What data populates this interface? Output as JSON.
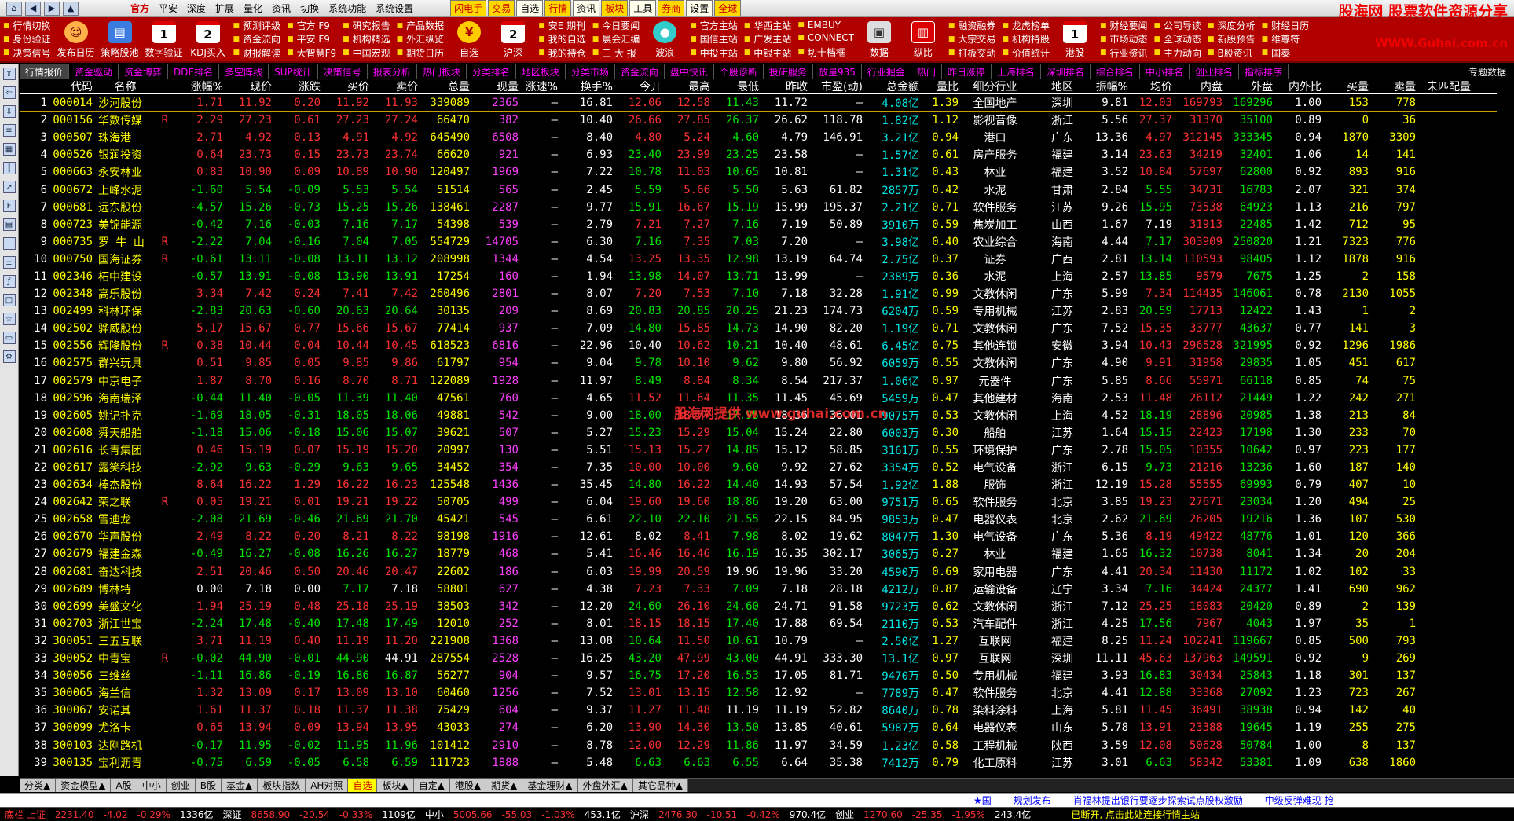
{
  "menubar": {
    "items": [
      "官方",
      "平安",
      "深度",
      "扩展",
      "量化",
      "资讯",
      "切换",
      "系统功能",
      "系统设置"
    ],
    "quick": [
      "闪电手",
      "交易",
      "自选",
      "行情",
      "资讯",
      "板块",
      "工具",
      "券商",
      "设置",
      "全球"
    ],
    "brand": "股海网 股票软件资源分享",
    "brand_sub": "WWW.Guhai.com.cn"
  },
  "toolbar": {
    "g1": [
      "行情切换",
      "身份验证",
      "决策信号"
    ],
    "big1": "发布日历",
    "big2": "策略股池",
    "big3": "数字验证",
    "big4": "KDJ买入",
    "g2": [
      "预测评级",
      "资金流向",
      "财报解读"
    ],
    "g3": [
      "官方 F9",
      "平安 F9",
      "大智慧F9"
    ],
    "g4": [
      "研究报告",
      "机构精选",
      "中国宏观"
    ],
    "g5": [
      "产品数据",
      "外汇纵览",
      "期货日历"
    ],
    "big5": "自选",
    "big6": "沪深",
    "g6": [
      "安E 期刊",
      "我的自选",
      "我的持仓"
    ],
    "g7": [
      "今日要闻",
      "晨会汇编",
      "三 大 报"
    ],
    "big7": "波浪",
    "g8": [
      "官方主站",
      "国信主站",
      "中投主站"
    ],
    "g9": [
      "华西主站",
      "广发主站",
      "中银主站"
    ],
    "g10": [
      "EMBUY",
      "CONNECT",
      "切十档框"
    ],
    "big8": "数据",
    "big9": "纵比",
    "g11": [
      "融资融券",
      "大宗交易",
      "打板交动"
    ],
    "g12": [
      "龙虎榜单",
      "机构持股",
      "价值统计"
    ],
    "big10": "港股",
    "g13": [
      "财经要闻",
      "市场动态",
      "行业资讯"
    ],
    "g14": [
      "公司导读",
      "全球动态",
      "主力动向"
    ],
    "g15": [
      "深度分析",
      "新股预告",
      "B股资讯"
    ],
    "g16": [
      "财经日历",
      "维尊符",
      "国泰"
    ]
  },
  "tabs": [
    "行情报价",
    "资金驱动",
    "资金博弈",
    "DDE排名",
    "多空阵线",
    "SUP统计",
    "决策信号",
    "报表分析",
    "热门板块",
    "分类排名",
    "地区板块",
    "分类市场",
    "资金流向",
    "盘中快讯",
    "个股诊断",
    "投研服务",
    "放量935",
    "行业掘金",
    "热门",
    "昨日涨停",
    "上海排名",
    "深圳排名",
    "综合排名",
    "中小排名",
    "创业排名",
    "指标排序"
  ],
  "tab_right": "专题数据",
  "headers": [
    "",
    "代码",
    "名称",
    "",
    "涨幅%",
    "现价",
    "涨跌",
    "买价",
    "卖价",
    "总量",
    "现量",
    "涨速%",
    "换手%",
    "今开",
    "最高",
    "最低",
    "昨收",
    "市盈(动)",
    "总金额",
    "量比",
    "细分行业",
    "地区",
    "振幅%",
    "均价",
    "内盘",
    "外盘",
    "内外比",
    "买量",
    "卖量",
    "未匹配量"
  ],
  "rows": [
    [
      "1",
      "000014",
      "沙河股份",
      "",
      "1.71",
      "11.92",
      "0.20",
      "11.92",
      "11.93",
      "339089",
      "2365",
      "–",
      "16.81",
      "12.06",
      "12.58",
      "11.43",
      "11.72",
      "–",
      "4.08亿",
      "1.39",
      "全国地产",
      "深圳",
      "9.81",
      "12.03",
      "169793",
      "169296",
      "1.00",
      "153",
      "778",
      ""
    ],
    [
      "2",
      "000156",
      "华数传媒",
      "R",
      "2.29",
      "27.23",
      "0.61",
      "27.23",
      "27.24",
      "66470",
      "382",
      "–",
      "10.40",
      "26.66",
      "27.85",
      "26.37",
      "26.62",
      "118.78",
      "1.82亿",
      "1.12",
      "影视音像",
      "浙江",
      "5.56",
      "27.37",
      "31370",
      "35100",
      "0.89",
      "0",
      "36",
      ""
    ],
    [
      "3",
      "000507",
      "珠海港",
      "",
      "2.71",
      "4.92",
      "0.13",
      "4.91",
      "4.92",
      "645490",
      "6508",
      "–",
      "8.40",
      "4.80",
      "5.24",
      "4.60",
      "4.79",
      "146.91",
      "3.21亿",
      "0.94",
      "港口",
      "广东",
      "13.36",
      "4.97",
      "312145",
      "333345",
      "0.94",
      "1870",
      "3309",
      ""
    ],
    [
      "4",
      "000526",
      "银润投资",
      "",
      "0.64",
      "23.73",
      "0.15",
      "23.73",
      "23.74",
      "66620",
      "921",
      "–",
      "6.93",
      "23.40",
      "23.99",
      "23.25",
      "23.58",
      "–",
      "1.57亿",
      "0.61",
      "房产服务",
      "福建",
      "3.14",
      "23.63",
      "34219",
      "32401",
      "1.06",
      "14",
      "141",
      ""
    ],
    [
      "5",
      "000663",
      "永安林业",
      "",
      "0.83",
      "10.90",
      "0.09",
      "10.89",
      "10.90",
      "120497",
      "1969",
      "–",
      "7.22",
      "10.78",
      "11.03",
      "10.65",
      "10.81",
      "–",
      "1.31亿",
      "0.43",
      "林业",
      "福建",
      "3.52",
      "10.84",
      "57697",
      "62800",
      "0.92",
      "893",
      "916",
      ""
    ],
    [
      "6",
      "000672",
      "上峰水泥",
      "",
      "-1.60",
      "5.54",
      "-0.09",
      "5.53",
      "5.54",
      "51514",
      "565",
      "–",
      "2.45",
      "5.59",
      "5.66",
      "5.50",
      "5.63",
      "61.82",
      "2857万",
      "0.42",
      "水泥",
      "甘肃",
      "2.84",
      "5.55",
      "34731",
      "16783",
      "2.07",
      "321",
      "374",
      ""
    ],
    [
      "7",
      "000681",
      "远东股份",
      "",
      "-4.57",
      "15.26",
      "-0.73",
      "15.25",
      "15.26",
      "138461",
      "2287",
      "–",
      "9.77",
      "15.91",
      "16.67",
      "15.19",
      "15.99",
      "195.37",
      "2.21亿",
      "0.71",
      "软件服务",
      "江苏",
      "9.26",
      "15.95",
      "73538",
      "64923",
      "1.13",
      "216",
      "797",
      ""
    ],
    [
      "8",
      "000723",
      "美锦能源",
      "",
      "-0.42",
      "7.16",
      "-0.03",
      "7.16",
      "7.17",
      "54398",
      "539",
      "–",
      "2.79",
      "7.21",
      "7.27",
      "7.16",
      "7.19",
      "50.89",
      "3910万",
      "0.59",
      "焦炭加工",
      "山西",
      "1.67",
      "7.19",
      "31913",
      "22485",
      "1.42",
      "712",
      "95",
      ""
    ],
    [
      "9",
      "000735",
      "罗 牛 山",
      "R",
      "-2.22",
      "7.04",
      "-0.16",
      "7.04",
      "7.05",
      "554729",
      "14705",
      "–",
      "6.30",
      "7.16",
      "7.35",
      "7.03",
      "7.20",
      "–",
      "3.98亿",
      "0.40",
      "农业综合",
      "海南",
      "4.44",
      "7.17",
      "303909",
      "250820",
      "1.21",
      "7323",
      "776",
      ""
    ],
    [
      "10",
      "000750",
      "国海证券",
      "R",
      "-0.61",
      "13.11",
      "-0.08",
      "13.11",
      "13.12",
      "208998",
      "1344",
      "–",
      "4.54",
      "13.25",
      "13.35",
      "12.98",
      "13.19",
      "64.74",
      "2.75亿",
      "0.37",
      "证券",
      "广西",
      "2.81",
      "13.14",
      "110593",
      "98405",
      "1.12",
      "1878",
      "916",
      ""
    ],
    [
      "11",
      "002346",
      "柘中建设",
      "",
      "-0.57",
      "13.91",
      "-0.08",
      "13.90",
      "13.91",
      "17254",
      "160",
      "–",
      "1.94",
      "13.98",
      "14.07",
      "13.71",
      "13.99",
      "–",
      "2389万",
      "0.36",
      "水泥",
      "上海",
      "2.57",
      "13.85",
      "9579",
      "7675",
      "1.25",
      "2",
      "158",
      ""
    ],
    [
      "12",
      "002348",
      "高乐股份",
      "",
      "3.34",
      "7.42",
      "0.24",
      "7.41",
      "7.42",
      "260496",
      "2801",
      "–",
      "8.07",
      "7.20",
      "7.53",
      "7.10",
      "7.18",
      "32.28",
      "1.91亿",
      "0.99",
      "文教休闲",
      "广东",
      "5.99",
      "7.34",
      "114435",
      "146061",
      "0.78",
      "2130",
      "1055",
      ""
    ],
    [
      "13",
      "002499",
      "科林环保",
      "",
      "-2.83",
      "20.63",
      "-0.60",
      "20.63",
      "20.64",
      "30135",
      "209",
      "–",
      "8.69",
      "20.83",
      "20.85",
      "20.25",
      "21.23",
      "174.73",
      "6204万",
      "0.59",
      "专用机械",
      "江苏",
      "2.83",
      "20.59",
      "17713",
      "12422",
      "1.43",
      "1",
      "2",
      ""
    ],
    [
      "14",
      "002502",
      "骅威股份",
      "",
      "5.17",
      "15.67",
      "0.77",
      "15.66",
      "15.67",
      "77414",
      "937",
      "–",
      "7.09",
      "14.80",
      "15.85",
      "14.73",
      "14.90",
      "82.20",
      "1.19亿",
      "0.71",
      "文教休闲",
      "广东",
      "7.52",
      "15.35",
      "33777",
      "43637",
      "0.77",
      "141",
      "3",
      ""
    ],
    [
      "15",
      "002556",
      "辉隆股份",
      "R",
      "0.38",
      "10.44",
      "0.04",
      "10.44",
      "10.45",
      "618523",
      "6816",
      "–",
      "22.96",
      "10.40",
      "10.62",
      "10.21",
      "10.40",
      "48.61",
      "6.45亿",
      "0.75",
      "其他连锁",
      "安徽",
      "3.94",
      "10.43",
      "296528",
      "321995",
      "0.92",
      "1296",
      "1986",
      ""
    ],
    [
      "16",
      "002575",
      "群兴玩具",
      "",
      "0.51",
      "9.85",
      "0.05",
      "9.85",
      "9.86",
      "61797",
      "954",
      "–",
      "9.04",
      "9.78",
      "10.10",
      "9.62",
      "9.80",
      "56.92",
      "6059万",
      "0.55",
      "文教休闲",
      "广东",
      "4.90",
      "9.91",
      "31958",
      "29835",
      "1.05",
      "451",
      "617",
      ""
    ],
    [
      "17",
      "002579",
      "中京电子",
      "",
      "1.87",
      "8.70",
      "0.16",
      "8.70",
      "8.71",
      "122089",
      "1928",
      "–",
      "11.97",
      "8.49",
      "8.84",
      "8.34",
      "8.54",
      "217.37",
      "1.06亿",
      "0.97",
      "元器件",
      "广东",
      "5.85",
      "8.66",
      "55971",
      "66118",
      "0.85",
      "74",
      "75",
      ""
    ],
    [
      "18",
      "002596",
      "海南瑞泽",
      "",
      "-0.44",
      "11.40",
      "-0.05",
      "11.39",
      "11.40",
      "47561",
      "760",
      "–",
      "4.65",
      "11.52",
      "11.64",
      "11.35",
      "11.45",
      "45.69",
      "5459万",
      "0.47",
      "其他建材",
      "海南",
      "2.53",
      "11.48",
      "26112",
      "21449",
      "1.22",
      "242",
      "271",
      ""
    ],
    [
      "19",
      "002605",
      "姚记扑克",
      "",
      "-1.69",
      "18.05",
      "-0.31",
      "18.05",
      "18.06",
      "49881",
      "542",
      "–",
      "9.00",
      "18.00",
      "18.77",
      "17.95",
      "18.36",
      "36.01",
      "9075万",
      "0.53",
      "文教休闲",
      "上海",
      "4.52",
      "18.19",
      "28896",
      "20985",
      "1.38",
      "213",
      "84",
      ""
    ],
    [
      "20",
      "002608",
      "舜天船舶",
      "",
      "-1.18",
      "15.06",
      "-0.18",
      "15.06",
      "15.07",
      "39621",
      "507",
      "–",
      "5.27",
      "15.23",
      "15.29",
      "15.04",
      "15.24",
      "22.80",
      "6003万",
      "0.30",
      "船舶",
      "江苏",
      "1.64",
      "15.15",
      "22423",
      "17198",
      "1.30",
      "233",
      "70",
      ""
    ],
    [
      "21",
      "002616",
      "长青集团",
      "",
      "0.46",
      "15.19",
      "0.07",
      "15.19",
      "15.20",
      "20997",
      "130",
      "–",
      "5.51",
      "15.13",
      "15.27",
      "14.85",
      "15.12",
      "58.85",
      "3161万",
      "0.55",
      "环境保护",
      "广东",
      "2.78",
      "15.05",
      "10355",
      "10642",
      "0.97",
      "223",
      "177",
      ""
    ],
    [
      "22",
      "002617",
      "露笑科技",
      "",
      "-2.92",
      "9.63",
      "-0.29",
      "9.63",
      "9.65",
      "34452",
      "354",
      "–",
      "7.35",
      "10.00",
      "10.00",
      "9.60",
      "9.92",
      "27.62",
      "3354万",
      "0.52",
      "电气设备",
      "浙江",
      "6.15",
      "9.73",
      "21216",
      "13236",
      "1.60",
      "187",
      "140",
      ""
    ],
    [
      "23",
      "002634",
      "棒杰股份",
      "",
      "8.64",
      "16.22",
      "1.29",
      "16.22",
      "16.23",
      "125548",
      "1436",
      "–",
      "35.45",
      "14.80",
      "16.22",
      "14.40",
      "14.93",
      "57.54",
      "1.92亿",
      "1.88",
      "服饰",
      "浙江",
      "12.19",
      "15.28",
      "55555",
      "69993",
      "0.79",
      "407",
      "10",
      ""
    ],
    [
      "24",
      "002642",
      "荣之联",
      "R",
      "0.05",
      "19.21",
      "0.01",
      "19.21",
      "19.22",
      "50705",
      "499",
      "–",
      "6.04",
      "19.60",
      "19.60",
      "18.86",
      "19.20",
      "63.00",
      "9751万",
      "0.65",
      "软件服务",
      "北京",
      "3.85",
      "19.23",
      "27671",
      "23034",
      "1.20",
      "494",
      "25",
      ""
    ],
    [
      "25",
      "002658",
      "雪迪龙",
      "",
      "-2.08",
      "21.69",
      "-0.46",
      "21.69",
      "21.70",
      "45421",
      "545",
      "–",
      "6.61",
      "22.10",
      "22.10",
      "21.55",
      "22.15",
      "84.95",
      "9853万",
      "0.47",
      "电器仪表",
      "北京",
      "2.62",
      "21.69",
      "26205",
      "19216",
      "1.36",
      "107",
      "530",
      ""
    ],
    [
      "26",
      "002670",
      "华声股份",
      "",
      "2.49",
      "8.22",
      "0.20",
      "8.21",
      "8.22",
      "98198",
      "1916",
      "–",
      "12.61",
      "8.02",
      "8.41",
      "7.98",
      "8.02",
      "19.62",
      "8047万",
      "1.30",
      "电气设备",
      "广东",
      "5.36",
      "8.19",
      "49422",
      "48776",
      "1.01",
      "120",
      "366",
      ""
    ],
    [
      "27",
      "002679",
      "福建金森",
      "",
      "-0.49",
      "16.27",
      "-0.08",
      "16.26",
      "16.27",
      "18779",
      "468",
      "–",
      "5.41",
      "16.46",
      "16.46",
      "16.19",
      "16.35",
      "302.17",
      "3065万",
      "0.27",
      "林业",
      "福建",
      "1.65",
      "16.32",
      "10738",
      "8041",
      "1.34",
      "20",
      "204",
      ""
    ],
    [
      "28",
      "002681",
      "奋达科技",
      "",
      "2.51",
      "20.46",
      "0.50",
      "20.46",
      "20.47",
      "22602",
      "186",
      "–",
      "6.03",
      "19.99",
      "20.59",
      "19.96",
      "19.96",
      "33.20",
      "4590万",
      "0.69",
      "家用电器",
      "广东",
      "4.41",
      "20.34",
      "11430",
      "11172",
      "1.02",
      "102",
      "33",
      ""
    ],
    [
      "29",
      "002689",
      "博林特",
      "",
      "0.00",
      "7.18",
      "0.00",
      "7.17",
      "7.18",
      "58801",
      "627",
      "–",
      "4.38",
      "7.23",
      "7.33",
      "7.09",
      "7.18",
      "28.18",
      "4212万",
      "0.87",
      "运输设备",
      "辽宁",
      "3.34",
      "7.16",
      "34424",
      "24377",
      "1.41",
      "690",
      "962",
      ""
    ],
    [
      "30",
      "002699",
      "美盛文化",
      "",
      "1.94",
      "25.19",
      "0.48",
      "25.18",
      "25.19",
      "38503",
      "342",
      "–",
      "12.20",
      "24.60",
      "26.10",
      "24.60",
      "24.71",
      "91.58",
      "9723万",
      "0.62",
      "文教休闲",
      "浙江",
      "7.12",
      "25.25",
      "18083",
      "20420",
      "0.89",
      "2",
      "139",
      ""
    ],
    [
      "31",
      "002703",
      "浙江世宝",
      "",
      "-2.24",
      "17.48",
      "-0.40",
      "17.48",
      "17.49",
      "12010",
      "252",
      "–",
      "8.01",
      "18.15",
      "18.15",
      "17.40",
      "17.88",
      "69.54",
      "2110万",
      "0.53",
      "汽车配件",
      "浙江",
      "4.25",
      "17.56",
      "7967",
      "4043",
      "1.97",
      "35",
      "1",
      ""
    ],
    [
      "32",
      "300051",
      "三五互联",
      "",
      "3.71",
      "11.19",
      "0.40",
      "11.19",
      "11.20",
      "221908",
      "1368",
      "–",
      "13.08",
      "10.64",
      "11.50",
      "10.61",
      "10.79",
      "–",
      "2.50亿",
      "1.27",
      "互联网",
      "福建",
      "8.25",
      "11.24",
      "102241",
      "119667",
      "0.85",
      "500",
      "793",
      ""
    ],
    [
      "33",
      "300052",
      "中青宝",
      "R",
      "-0.02",
      "44.90",
      "-0.01",
      "44.90",
      "44.91",
      "287554",
      "2528",
      "–",
      "16.25",
      "43.20",
      "47.99",
      "43.00",
      "44.91",
      "333.30",
      "13.1亿",
      "0.97",
      "互联网",
      "深圳",
      "11.11",
      "45.63",
      "137963",
      "149591",
      "0.92",
      "9",
      "269",
      ""
    ],
    [
      "34",
      "300056",
      "三维丝",
      "",
      "-1.11",
      "16.86",
      "-0.19",
      "16.86",
      "16.87",
      "56277",
      "904",
      "–",
      "9.57",
      "16.75",
      "17.20",
      "16.53",
      "17.05",
      "81.71",
      "9470万",
      "0.50",
      "专用机械",
      "福建",
      "3.93",
      "16.83",
      "30434",
      "25843",
      "1.18",
      "301",
      "137",
      ""
    ],
    [
      "35",
      "300065",
      "海兰信",
      "",
      "1.32",
      "13.09",
      "0.17",
      "13.09",
      "13.10",
      "60460",
      "1256",
      "–",
      "7.52",
      "13.01",
      "13.15",
      "12.58",
      "12.92",
      "–",
      "7789万",
      "0.47",
      "软件服务",
      "北京",
      "4.41",
      "12.88",
      "33368",
      "27092",
      "1.23",
      "723",
      "267",
      ""
    ],
    [
      "36",
      "300067",
      "安诺其",
      "",
      "1.61",
      "11.37",
      "0.18",
      "11.37",
      "11.38",
      "75429",
      "604",
      "–",
      "9.37",
      "11.27",
      "11.48",
      "11.19",
      "11.19",
      "52.82",
      "8640万",
      "0.78",
      "染料涂料",
      "上海",
      "5.81",
      "11.45",
      "36491",
      "38938",
      "0.94",
      "142",
      "40",
      ""
    ],
    [
      "37",
      "300099",
      "尤洛卡",
      "",
      "0.65",
      "13.94",
      "0.09",
      "13.94",
      "13.95",
      "43033",
      "274",
      "–",
      "6.20",
      "13.90",
      "14.30",
      "13.50",
      "13.85",
      "40.61",
      "5987万",
      "0.64",
      "电器仪表",
      "山东",
      "5.78",
      "13.91",
      "23388",
      "19645",
      "1.19",
      "255",
      "275",
      ""
    ],
    [
      "38",
      "300103",
      "达刚路机",
      "",
      "-0.17",
      "11.95",
      "-0.02",
      "11.95",
      "11.96",
      "101412",
      "2910",
      "–",
      "8.78",
      "12.00",
      "12.29",
      "11.86",
      "11.97",
      "34.59",
      "1.23亿",
      "0.58",
      "工程机械",
      "陕西",
      "3.59",
      "12.08",
      "50628",
      "50784",
      "1.00",
      "8",
      "137",
      ""
    ],
    [
      "39",
      "300135",
      "宝利沥青",
      "",
      "-0.75",
      "6.59",
      "-0.05",
      "6.58",
      "6.59",
      "111723",
      "1888",
      "–",
      "5.48",
      "6.63",
      "6.63",
      "6.55",
      "6.64",
      "35.38",
      "7412万",
      "0.79",
      "化工原料",
      "江苏",
      "3.01",
      "6.63",
      "58342",
      "53381",
      "1.09",
      "638",
      "1860",
      ""
    ]
  ],
  "bottom_tabs": [
    "分类▲",
    "资金模型▲",
    "A股",
    "中小",
    "创业",
    "B股",
    "基金▲",
    "板块指数",
    "AH对照",
    "自选",
    "板块▲",
    "自定▲",
    "港股▲",
    "期货▲",
    "基金理财▲",
    "外盘外汇▲",
    "其它品种▲"
  ],
  "news": [
    "★国",
    "规划发布",
    "肖福林提出银行要逐步探索试点股权激励",
    "中级反弹难现 抢"
  ],
  "status": {
    "sh_label": "底栏 上证",
    "sh_val": "2231.40",
    "sh_chg": "-4.02",
    "sh_pct": "-0.29%",
    "sh_amt": "1336亿",
    "sz_label": "深证",
    "sz_val": "8658.90",
    "sz_chg": "-20.54",
    "sz_pct": "-0.33%",
    "sz_amt": "1109亿",
    "zx_label": "中小",
    "zx_val": "5005.66",
    "zx_chg": "-55.03",
    "zx_pct": "-1.03%",
    "zx_amt": "453.1亿",
    "hs_label": "沪深",
    "hs_val": "2476.30",
    "hs_chg": "-10.51",
    "hs_pct": "-0.42%",
    "hs_amt": "970.4亿",
    "cy_label": "创业",
    "cy_val": "1270.60",
    "cy_chg": "-25.35",
    "cy_pct": "-1.95%",
    "cy_amt": "243.4亿",
    "msg": "已断开, 点击此处连接行情主站"
  },
  "watermark": "股海网提供 www.guhai.com.cn"
}
